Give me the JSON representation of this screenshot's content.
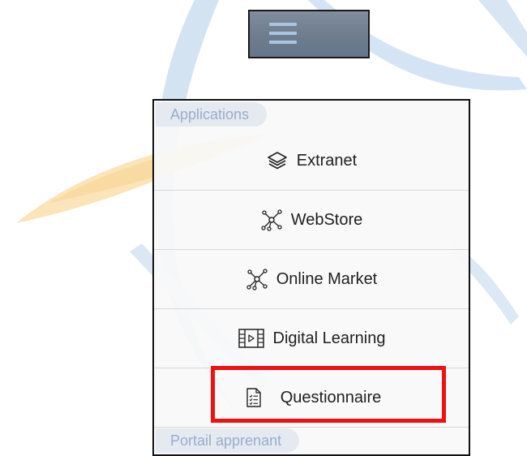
{
  "colors": {
    "logo_blue": "#5b9bd5",
    "logo_orange": "#f4b63b",
    "highlight_red": "#ee1111",
    "header_text": "#9aaccb"
  },
  "menu": {
    "sections": [
      {
        "title": "Applications",
        "items": [
          {
            "label": "Extranet",
            "icon": "layers-icon"
          },
          {
            "label": "WebStore",
            "icon": "network-icon"
          },
          {
            "label": "Online Market",
            "icon": "network-icon"
          },
          {
            "label": "Digital Learning",
            "icon": "film-play-icon"
          },
          {
            "label": "Questionnaire",
            "icon": "document-list-icon"
          }
        ]
      },
      {
        "title": "Portail apprenant",
        "items": []
      }
    ]
  },
  "highlighted_item": "Questionnaire"
}
